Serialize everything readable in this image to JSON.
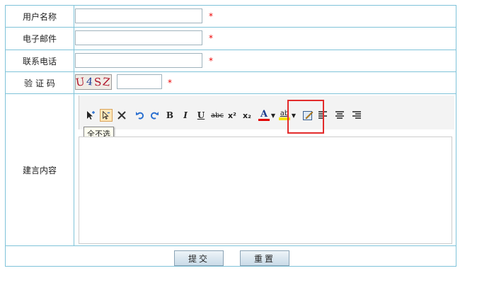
{
  "form": {
    "username": {
      "label": "用户名称",
      "required_mark": "*",
      "value": ""
    },
    "email": {
      "label": "电子邮件",
      "required_mark": "*",
      "value": ""
    },
    "phone": {
      "label": "联系电话",
      "required_mark": "*",
      "value": ""
    },
    "captcha": {
      "label": "验 证 码",
      "image_text": [
        "U",
        "4",
        "S",
        "Z"
      ],
      "required_mark": "*",
      "value": ""
    },
    "suggestion": {
      "label": "建言内容"
    }
  },
  "toolbar": {
    "tooltip": "全不选",
    "buttons": {
      "bold": "B",
      "italic": "I",
      "underline": "U",
      "strike": "abc",
      "superscript": "x²",
      "subscript": "x₂",
      "font_color": "A",
      "highlight": "ab"
    },
    "colors": {
      "font_color": "#e00000",
      "highlight": "#f5e400"
    }
  },
  "actions": {
    "submit": "提交",
    "reset": "重置"
  }
}
